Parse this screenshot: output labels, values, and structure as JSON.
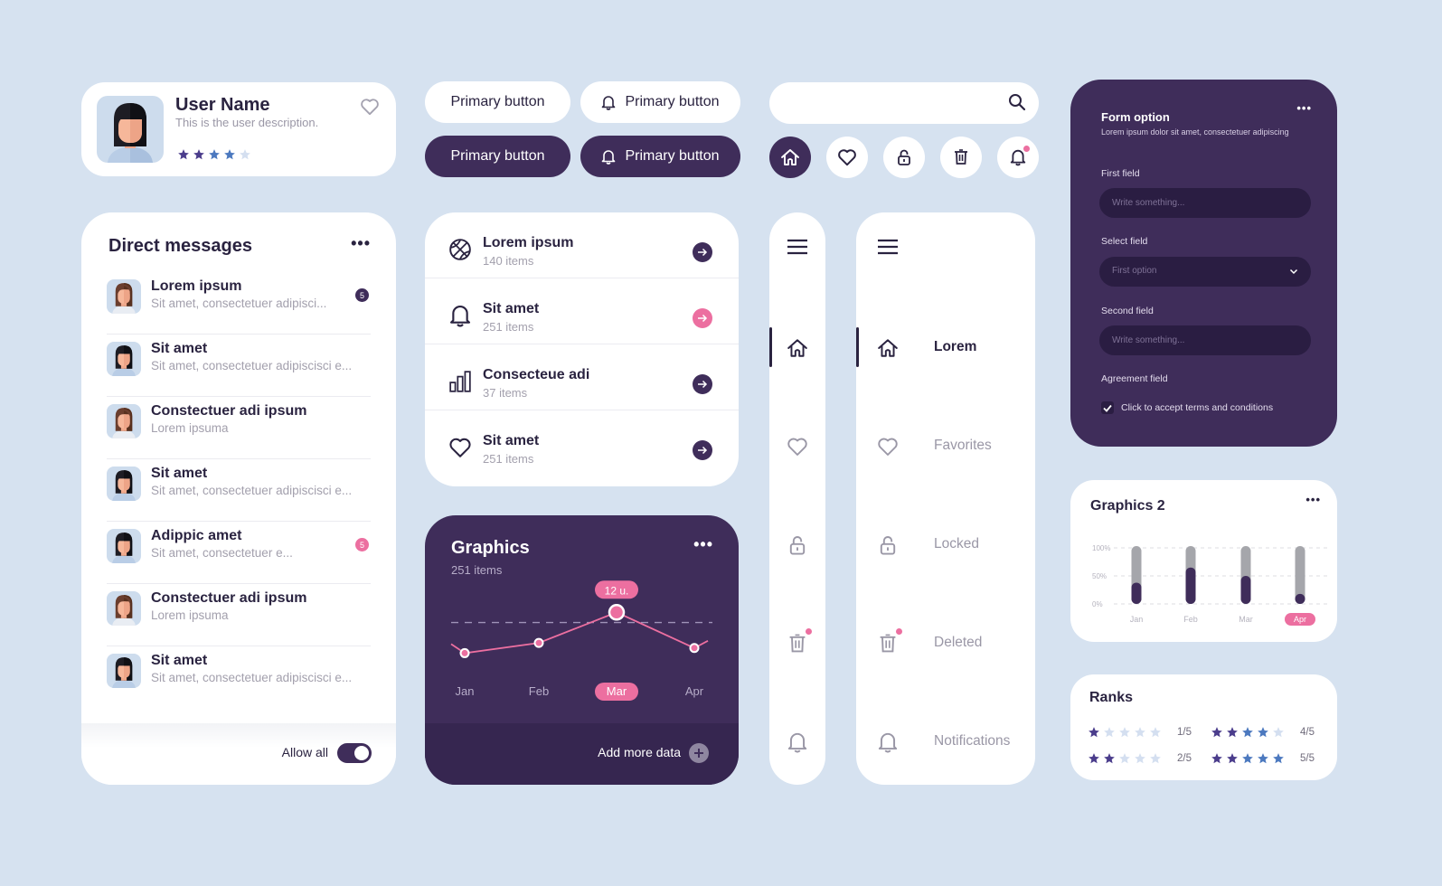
{
  "colors": {
    "background": "#d6e2f0",
    "primary_dark": "#3f2d5a",
    "accent_pink": "#ec6fa0",
    "text_dark": "#2a2340",
    "text_muted": "#a3a0ad",
    "star_filled": "#4b3d8c",
    "star_blue": "#4c79bf",
    "star_empty": "#d4dff0"
  },
  "user_card": {
    "name": "User Name",
    "description": "This is the user description.",
    "rating": 4,
    "rating_max": 5,
    "favorite_icon": "heart-outline-icon"
  },
  "buttons": {
    "primary_light": "Primary button",
    "primary_light_icon": "Primary button",
    "primary_dark": "Primary button",
    "primary_dark_icon": "Primary button",
    "icon": "bell-icon"
  },
  "search": {
    "value": "",
    "placeholder": "",
    "icon": "search-icon"
  },
  "icon_buttons": [
    {
      "icon": "home-icon",
      "active": true
    },
    {
      "icon": "heart-icon",
      "active": false
    },
    {
      "icon": "lock-icon",
      "active": false
    },
    {
      "icon": "trash-icon",
      "active": false
    },
    {
      "icon": "bell-icon",
      "active": false,
      "notification_dot": true
    }
  ],
  "direct_messages": {
    "title": "Direct messages",
    "more_label": "•••",
    "items": [
      {
        "name": "Lorem ipsum",
        "preview": "Sit amet, consectetuer adipisci...",
        "badge": "5",
        "badge_color": "dark",
        "hair": "brown"
      },
      {
        "name": "Sit amet",
        "preview": "Sit amet, consectetuer adipiscisci e...",
        "badge": null,
        "hair": "black"
      },
      {
        "name": "Constectuer adi ipsum",
        "preview": "Lorem ipsuma",
        "badge": null,
        "hair": "brown"
      },
      {
        "name": "Sit amet",
        "preview": "Sit amet, consectetuer adipiscisci e...",
        "badge": null,
        "hair": "black"
      },
      {
        "name": "Adippic amet",
        "preview": "Sit amet, consectetuer e...",
        "badge": "5",
        "badge_color": "pink",
        "hair": "black"
      },
      {
        "name": "Constectuer adi ipsum",
        "preview": "Lorem ipsuma",
        "badge": null,
        "hair": "brown"
      },
      {
        "name": "Sit amet",
        "preview": "Sit amet, consectetuer adipiscisci e...",
        "badge": null,
        "hair": "black"
      }
    ],
    "footer": {
      "toggle_label": "Allow all",
      "toggle_on": true
    }
  },
  "categories": [
    {
      "icon": "basketball-icon",
      "name": "Lorem ipsum",
      "count": "140 items",
      "arrow_color": "dark"
    },
    {
      "icon": "bell-icon",
      "name": "Sit amet",
      "count": "251 items",
      "arrow_color": "pink"
    },
    {
      "icon": "bar-chart-icon",
      "name": "Consecteue adi",
      "count": "37 items",
      "arrow_color": "dark"
    },
    {
      "icon": "heart-icon",
      "name": "Sit amet",
      "count": "251 items",
      "arrow_color": "dark"
    }
  ],
  "graphics": {
    "title": "Graphics",
    "subtitle": "251 items",
    "more_label": "•••",
    "add_label": "Add more data"
  },
  "nav": {
    "items": [
      {
        "icon": "home-icon",
        "label": "Lorem",
        "active": true,
        "dot": false
      },
      {
        "icon": "heart-icon",
        "label": "Favorites",
        "active": false,
        "dot": false
      },
      {
        "icon": "lock-icon",
        "label": "Locked",
        "active": false,
        "dot": false
      },
      {
        "icon": "trash-icon",
        "label": "Deleted",
        "active": false,
        "dot": true
      },
      {
        "icon": "bell-icon",
        "label": "Notifications",
        "active": false,
        "dot": false
      }
    ]
  },
  "form": {
    "title": "Form option",
    "subtitle": "Lorem ipsum dolor sit amet, consectetuer adipiscing",
    "more_label": "•••",
    "first_field": {
      "label": "First field",
      "value": "",
      "placeholder": "Write something..."
    },
    "select_field": {
      "label": "Select field",
      "value": "First option"
    },
    "second_field": {
      "label": "Second field",
      "value": "",
      "placeholder": "Write something..."
    },
    "agreement": {
      "label": "Agreement field",
      "checkbox_label": "Click to accept terms and conditions",
      "checked": true
    }
  },
  "graphics2": {
    "title": "Graphics  2",
    "more_label": "•••"
  },
  "ranks": {
    "title": "Ranks",
    "items": [
      {
        "value": 1,
        "label": "1/5"
      },
      {
        "value": 4,
        "label": "4/5"
      },
      {
        "value": 2,
        "label": "2/5"
      },
      {
        "value": 5,
        "label": "5/5"
      }
    ]
  },
  "chart_data": [
    {
      "type": "line",
      "title": "Graphics",
      "subtitle": "251 items",
      "categories": [
        "Jan",
        "Feb",
        "Mar",
        "Apr"
      ],
      "values": [
        4,
        6,
        12,
        5
      ],
      "highlight": {
        "category": "Mar",
        "label": "12 u."
      },
      "reference_line": 10,
      "ylim": [
        0,
        14
      ],
      "xlabel": "",
      "ylabel": "",
      "grid": false
    },
    {
      "type": "bar",
      "title": "Graphics  2",
      "categories": [
        "Jan",
        "Feb",
        "Mar",
        "Apr"
      ],
      "values": [
        38,
        65,
        50,
        18
      ],
      "max_values": [
        100,
        100,
        100,
        100
      ],
      "highlight": "Apr",
      "yticks": [
        "0%",
        "50%",
        "100%"
      ],
      "ylim": [
        0,
        100
      ],
      "grid": true
    }
  ]
}
